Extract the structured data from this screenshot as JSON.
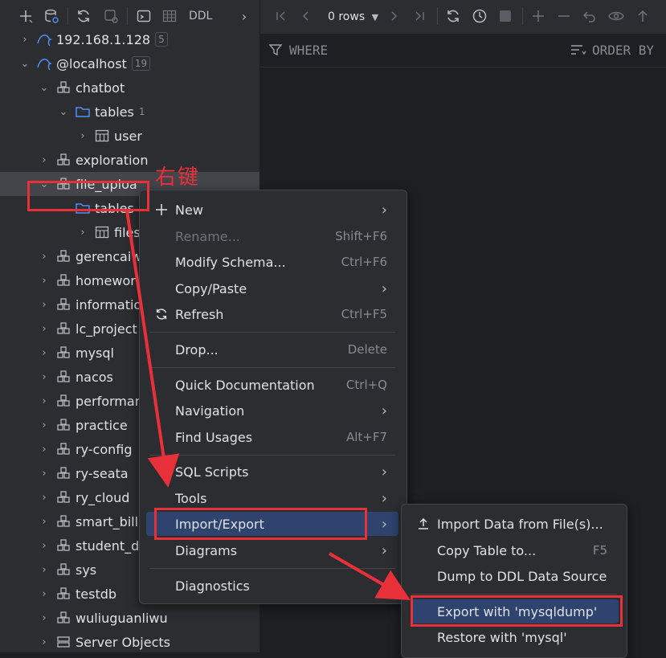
{
  "left_toolbar": {
    "ddl_label": "DDL"
  },
  "tree": {
    "items": [
      {
        "label": "192.168.1.128",
        "badge": "5"
      },
      {
        "label": "@localhost",
        "badge": "19"
      },
      {
        "label": "chatbot"
      },
      {
        "label": "tables",
        "count": "1"
      },
      {
        "label": "user"
      },
      {
        "label": "exploration"
      },
      {
        "label": "file_uploa"
      },
      {
        "label": "tables"
      },
      {
        "label": "files"
      },
      {
        "label": "gerencaiwu"
      },
      {
        "label": "homework"
      },
      {
        "label": "information"
      },
      {
        "label": "lc_project"
      },
      {
        "label": "mysql"
      },
      {
        "label": "nacos"
      },
      {
        "label": "performance"
      },
      {
        "label": "practice"
      },
      {
        "label": "ry-config"
      },
      {
        "label": "ry-seata"
      },
      {
        "label": "ry_cloud"
      },
      {
        "label": "smart_bill"
      },
      {
        "label": "student_d"
      },
      {
        "label": "sys"
      },
      {
        "label": "testdb"
      },
      {
        "label": "wuliuguanliwu"
      },
      {
        "label": "Server Objects"
      }
    ]
  },
  "annotation": {
    "right_click_label": "右键"
  },
  "right_toolbar": {
    "rows_label": "0 rows"
  },
  "filter_bar": {
    "where_label": "WHERE",
    "order_by_label": "ORDER BY"
  },
  "context_menu": {
    "items": [
      {
        "label": "New",
        "shortcut": ""
      },
      {
        "label": "Rename...",
        "shortcut": "Shift+F6"
      },
      {
        "label": "Modify Schema...",
        "shortcut": "Ctrl+F6"
      },
      {
        "label": "Copy/Paste",
        "shortcut": ""
      },
      {
        "label": "Refresh",
        "shortcut": "Ctrl+F5"
      },
      {
        "label": "Drop...",
        "shortcut": "Delete"
      },
      {
        "label": "Quick Documentation",
        "shortcut": "Ctrl+Q"
      },
      {
        "label": "Navigation",
        "shortcut": ""
      },
      {
        "label": "Find Usages",
        "shortcut": "Alt+F7"
      },
      {
        "label": "SQL Scripts",
        "shortcut": ""
      },
      {
        "label": "Tools",
        "shortcut": ""
      },
      {
        "label": "Import/Export",
        "shortcut": ""
      },
      {
        "label": "Diagrams",
        "shortcut": ""
      },
      {
        "label": "Diagnostics",
        "shortcut": ""
      }
    ]
  },
  "submenu": {
    "items": [
      {
        "label": "Import Data from File(s)...",
        "shortcut": ""
      },
      {
        "label": "Copy Table to...",
        "shortcut": "F5"
      },
      {
        "label": "Dump to DDL Data Source",
        "shortcut": ""
      },
      {
        "label": "Export with 'mysqldump'",
        "shortcut": ""
      },
      {
        "label": "Restore with 'mysql'",
        "shortcut": ""
      }
    ]
  },
  "colors": {
    "accent_red": "#e8303a",
    "highlight": "#2e436e",
    "folder_blue": "#4f8ef7"
  }
}
